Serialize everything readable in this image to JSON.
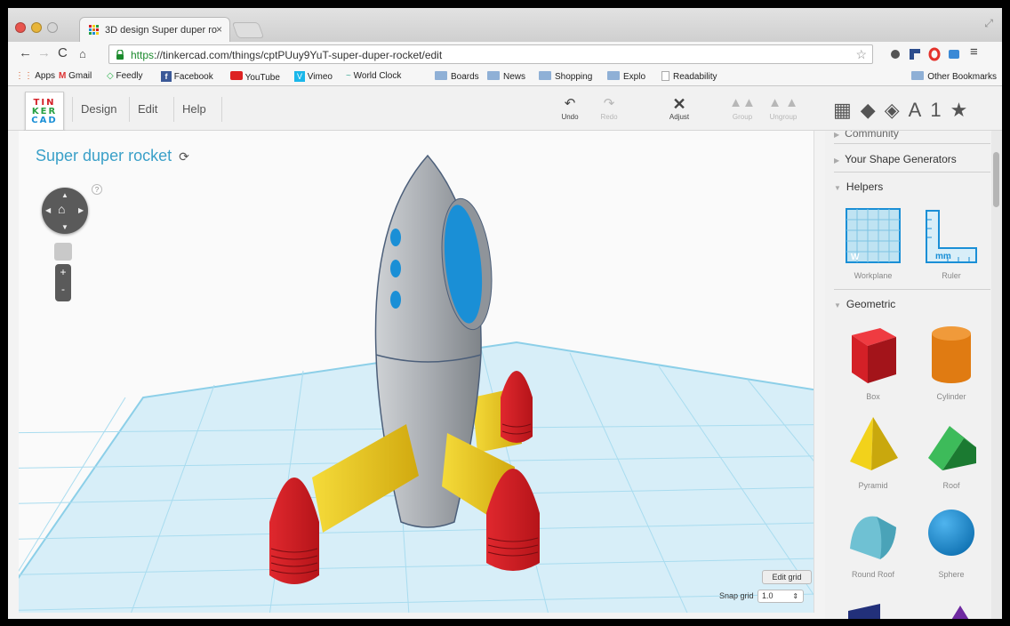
{
  "browser": {
    "tab_title": "3D design Super duper ro",
    "url_scheme": "https",
    "url_rest": "://tinkercad.com/things/cptPUuy9YuT-super-duper-rocket/edit",
    "bookmarks": [
      "Apps",
      "Gmail",
      "Feedly",
      "Facebook",
      "YouTube",
      "Vimeo",
      "World Clock",
      "Boards",
      "News",
      "Shopping",
      "Explo",
      "Readability"
    ],
    "other_bookmarks": "Other Bookmarks"
  },
  "app": {
    "logo_lines": [
      "TIN",
      "KER",
      "CAD"
    ],
    "menu": [
      "Design",
      "Edit",
      "Help"
    ],
    "tools": {
      "undo": "Undo",
      "redo": "Redo",
      "adjust": "Adjust",
      "group": "Group",
      "ungroup": "Ungroup"
    },
    "view_glyphs": {
      "text": "A",
      "number": "1"
    }
  },
  "viewport": {
    "design_title": "Super duper rocket",
    "help": "?",
    "zoom_in": "+",
    "zoom_out": "-",
    "edit_grid": "Edit grid",
    "snap_label": "Snap grid",
    "snap_value": "1.0"
  },
  "sidebar": {
    "community": "Community",
    "shape_generators": "Your Shape Generators",
    "helpers": "Helpers",
    "helper_items": [
      "Workplane",
      "Ruler"
    ],
    "ruler_unit": "mm",
    "workplane_mark": "W",
    "geometric": "Geometric",
    "geometric_items": [
      "Box",
      "Cylinder",
      "Pyramid",
      "Roof",
      "Round Roof",
      "Sphere"
    ]
  },
  "colors": {
    "accent": "#3aa0c8",
    "grid": "#bfe3f2",
    "box": "#d42027",
    "cylinder": "#e07b12",
    "pyramid": "#f2d21b",
    "roof": "#26a042",
    "roundroof": "#6fc1d3",
    "sphere": "#1a8fd6"
  }
}
